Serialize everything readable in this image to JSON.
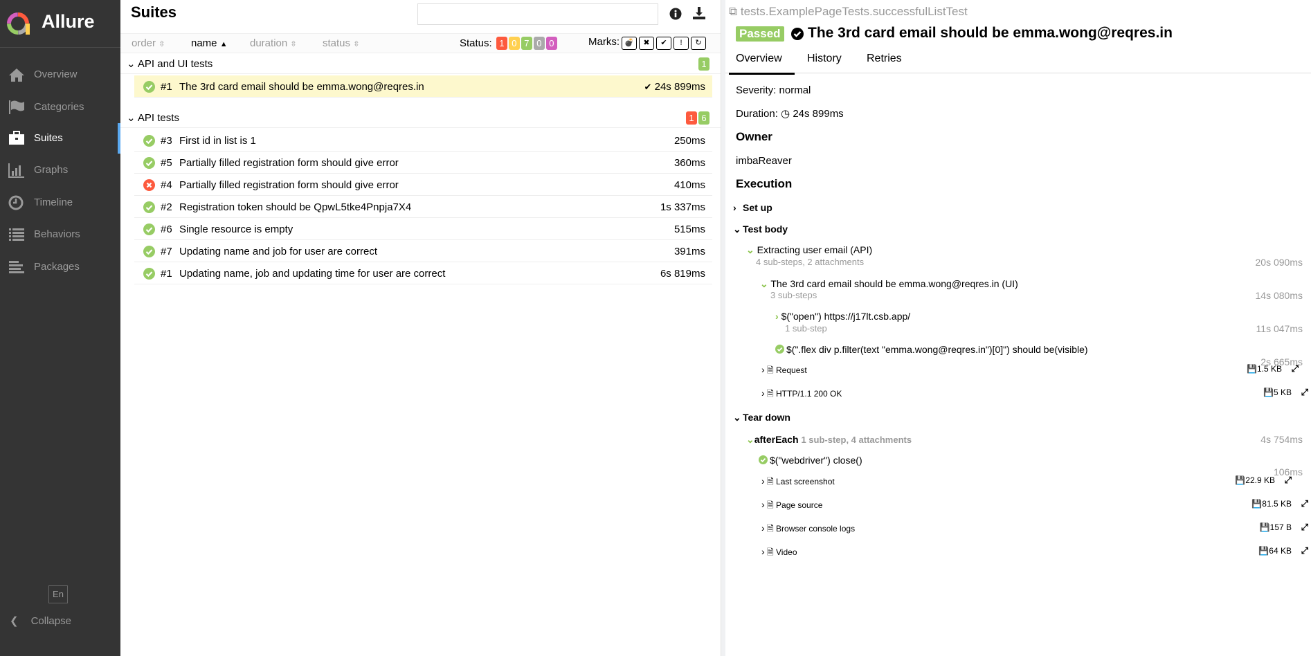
{
  "app": {
    "name": "Allure"
  },
  "sidebar": {
    "items": [
      {
        "label": "Overview",
        "icon": "home-icon"
      },
      {
        "label": "Categories",
        "icon": "flag-icon"
      },
      {
        "label": "Suites",
        "icon": "briefcase-icon",
        "active": true
      },
      {
        "label": "Graphs",
        "icon": "bar-chart-icon"
      },
      {
        "label": "Timeline",
        "icon": "clock-icon"
      },
      {
        "label": "Behaviors",
        "icon": "list-icon"
      },
      {
        "label": "Packages",
        "icon": "align-left-icon"
      }
    ],
    "lang": "En",
    "collapse": "Collapse"
  },
  "suites": {
    "title": "Suites",
    "search_value": "",
    "sort": {
      "order": "order",
      "name": "name",
      "duration": "duration",
      "status": "status"
    },
    "status_label": "Status:",
    "status_counts": {
      "failed": "1",
      "broken": "0",
      "passed": "7",
      "skipped": "0",
      "unknown": "0"
    },
    "marks_label": "Marks:",
    "groups": [
      {
        "name": "API and UI tests",
        "counts": {
          "passed": "1"
        },
        "rows": [
          {
            "status": "passed",
            "num": "#1",
            "name": "The 3rd card email should be emma.wong@reqres.in",
            "duration": "24s 899ms",
            "selected": true
          }
        ]
      },
      {
        "name": "API tests",
        "counts": {
          "failed": "1",
          "passed": "6"
        },
        "rows": [
          {
            "status": "passed",
            "num": "#3",
            "name": "First id in list is 1",
            "duration": "250ms"
          },
          {
            "status": "passed",
            "num": "#5",
            "name": "Partially filled registration form should give error",
            "duration": "360ms"
          },
          {
            "status": "failed",
            "num": "#4",
            "name": "Partially filled registration form should give error",
            "duration": "410ms"
          },
          {
            "status": "passed",
            "num": "#2",
            "name": "Registration token should be QpwL5tke4Pnpja7X4",
            "duration": "1s 337ms"
          },
          {
            "status": "passed",
            "num": "#6",
            "name": "Single resource is empty",
            "duration": "515ms"
          },
          {
            "status": "passed",
            "num": "#7",
            "name": "Updating name and job for user are correct",
            "duration": "391ms"
          },
          {
            "status": "passed",
            "num": "#1",
            "name": "Updating name, job and updating time for user are correct",
            "duration": "6s 819ms"
          }
        ]
      }
    ]
  },
  "colors": {
    "passed": "#97cc64",
    "failed": "#fd5a3e",
    "broken": "#ffd050",
    "skipped": "#aaaaaa",
    "unknown": "#d35ebe",
    "sidebar": "#343434",
    "active": "#5aa9f0",
    "selected_row": "#fdf8cd"
  },
  "detail": {
    "breadcrumb": "tests.ExamplePageTests.successfulListTest",
    "status": "Passed",
    "title": "The 3rd card email should be emma.wong@reqres.in",
    "tabs": [
      "Overview",
      "History",
      "Retries"
    ],
    "severity": "Severity: normal",
    "duration_label": "Duration:",
    "duration": "24s 899ms",
    "owner_heading": "Owner",
    "owner": "imbaReaver",
    "execution_heading": "Execution",
    "setup": "Set up",
    "testbody": "Test body",
    "teardown": "Tear down",
    "steps": {
      "s1": {
        "name": "Extracting user email (API)",
        "meta": "4 sub-steps, 2 attachments",
        "duration": "20s 090ms"
      },
      "s2": {
        "name": "The 3rd card email should be emma.wong@reqres.in (UI)",
        "meta": "3 sub-steps",
        "duration": "14s 080ms"
      },
      "s3": {
        "name": "$(\"open\") https://j17lt.csb.app/",
        "meta": "1 sub-step",
        "duration": "11s 047ms"
      },
      "s4": {
        "name": "$(\".flex div p.filter(text \"emma.wong@reqres.in\")[0]\") should be(visible)",
        "duration": "2s 665ms"
      },
      "a1": {
        "name": "Request",
        "size": "1.5 KB"
      },
      "a2": {
        "name": "HTTP/1.1 200 OK",
        "size": "5 KB"
      },
      "t1": {
        "name": "afterEach",
        "meta": "1 sub-step, 4 attachments",
        "duration": "4s 754ms"
      },
      "t2": {
        "name": "$(\"webdriver\") close()",
        "duration": "106ms"
      },
      "a3": {
        "name": "Last screenshot",
        "size": "22.9 KB"
      },
      "a4": {
        "name": "Page source",
        "size": "81.5 KB"
      },
      "a5": {
        "name": "Browser console logs",
        "size": "157 B"
      },
      "a6": {
        "name": "Video",
        "size": "64 KB"
      }
    }
  }
}
